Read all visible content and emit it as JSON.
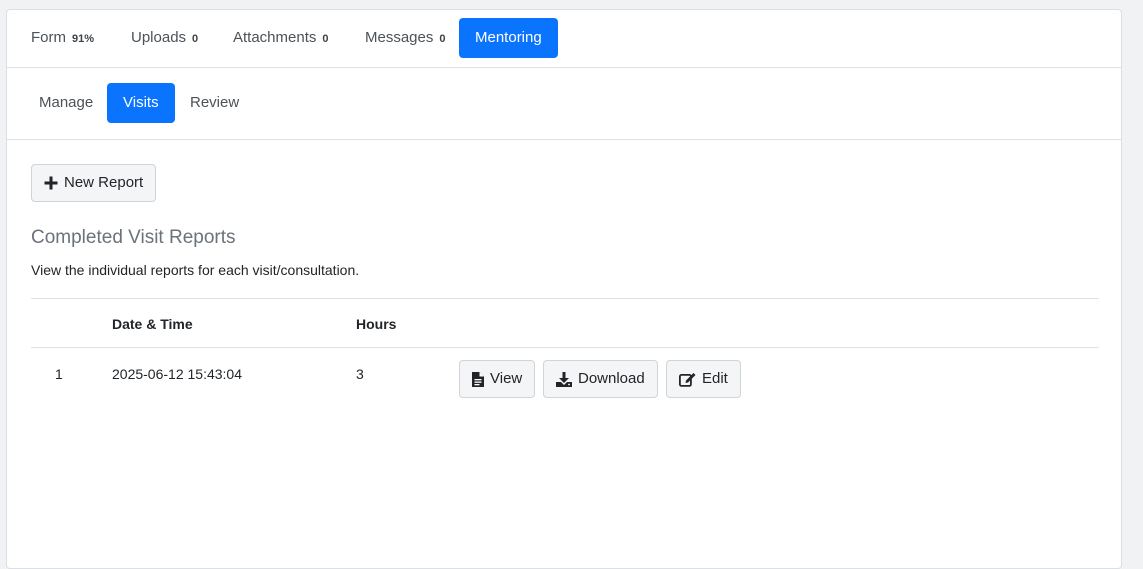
{
  "top_tabs": [
    {
      "label": "Form",
      "badge": "91%"
    },
    {
      "label": "Uploads",
      "badge": "0"
    },
    {
      "label": "Attachments",
      "badge": "0"
    },
    {
      "label": "Messages",
      "badge": "0"
    },
    {
      "label": "Mentoring",
      "active": true
    }
  ],
  "sub_tabs": [
    {
      "label": "Manage"
    },
    {
      "label": "Visits",
      "active": true
    },
    {
      "label": "Review"
    }
  ],
  "new_report_label": "New Report",
  "section": {
    "title": "Completed Visit Reports",
    "description": "View the individual reports for each visit/consultation."
  },
  "table": {
    "headers": [
      "",
      "Date & Time",
      "Hours",
      ""
    ],
    "rows": [
      {
        "num": "1",
        "datetime": "2025-06-12 15:43:04",
        "hours": "3"
      }
    ]
  },
  "row_actions": {
    "view": "View",
    "download": "Download",
    "edit": "Edit"
  },
  "colors": {
    "accent": "#0a74ff",
    "border": "#dee2e6",
    "muted_text": "#6a737b"
  },
  "icons": [
    "plus-icon",
    "file-icon",
    "download-icon",
    "edit-icon"
  ]
}
